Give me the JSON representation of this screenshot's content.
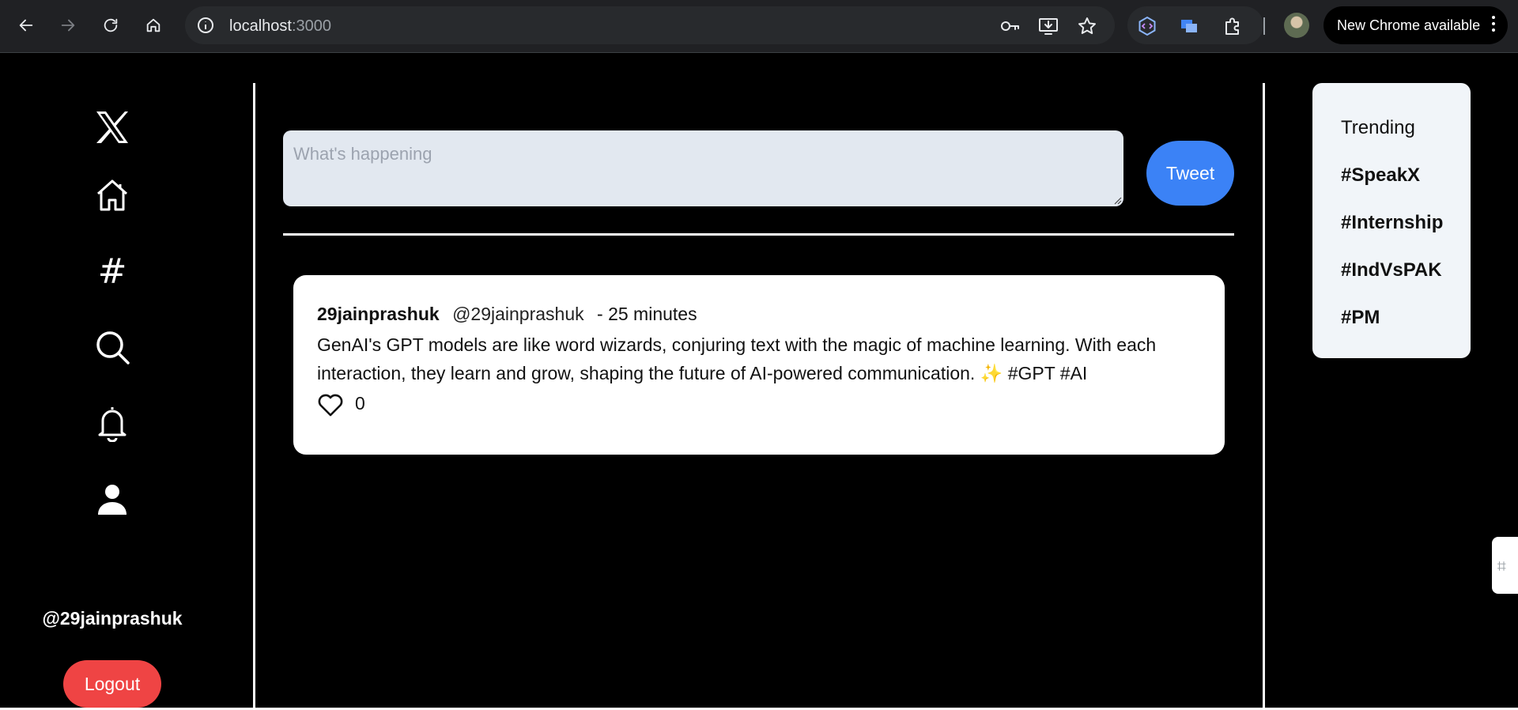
{
  "browser": {
    "url_host": "localhost",
    "url_port": ":3000",
    "new_chrome_label": "New Chrome available"
  },
  "sidebar": {
    "items": [
      {
        "name": "logo",
        "icon": "x-logo-icon"
      },
      {
        "name": "home",
        "icon": "home-icon"
      },
      {
        "name": "explore",
        "icon": "hashtag-icon",
        "glyph": "#"
      },
      {
        "name": "search",
        "icon": "search-icon"
      },
      {
        "name": "notifications",
        "icon": "bell-icon"
      },
      {
        "name": "profile",
        "icon": "user-icon"
      }
    ],
    "username": "@29jainprashuk",
    "logout_label": "Logout"
  },
  "composer": {
    "placeholder": "What's happening",
    "tweet_label": "Tweet"
  },
  "feed": {
    "tweets": [
      {
        "name": "29jainprashuk",
        "handle": "@29jainprashuk",
        "time": "- 25 minutes",
        "text": "GenAI's GPT models are like word wizards, conjuring text with the magic of machine learning. With each interaction, they learn and grow, shaping the future of AI-powered communication. ✨ #GPT #AI",
        "likes": "0"
      }
    ]
  },
  "trending": {
    "title": "Trending",
    "items": [
      "#SpeakX",
      "#Internship",
      "#IndVsPAK",
      "#PM"
    ]
  },
  "colors": {
    "tweet_button": "#3b82f6",
    "logout_button": "#ef4444",
    "page_background": "#000000",
    "composer_background": "#e2e8f0"
  }
}
